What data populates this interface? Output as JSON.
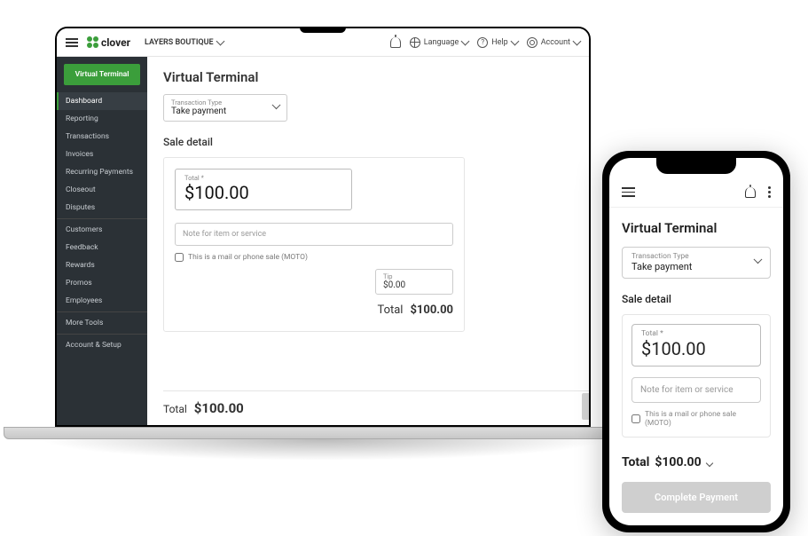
{
  "brand": "clover",
  "merchant": "LAYERS BOUTIQUE",
  "topnav": {
    "language": "Language",
    "help": "Help",
    "account": "Account"
  },
  "sidebar": {
    "vt_button": "Virtual Terminal",
    "items": [
      "Dashboard",
      "Reporting",
      "Transactions",
      "Invoices",
      "Recurring Payments",
      "Closeout",
      "Disputes",
      "Customers",
      "Feedback",
      "Rewards",
      "Promos",
      "Employees",
      "More Tools",
      "Account & Setup"
    ],
    "active_index": 0,
    "dividers_after": [
      6,
      11,
      12
    ]
  },
  "desktop": {
    "title": "Virtual Terminal",
    "txn_type_label": "Transaction Type",
    "txn_type_value": "Take payment",
    "sale_title": "Sale detail",
    "total_label": "Total *",
    "amount": "$100.00",
    "note_placeholder": "Note for item or service",
    "moto_label": "This is a mail or phone sale (MOTO)",
    "tip_label": "Tip",
    "tip_value": "$0.00",
    "inner_total_label": "Total",
    "inner_total_value": "$100.00",
    "footer_total_label": "Total",
    "footer_total_value": "$100.00"
  },
  "mobile": {
    "title": "Virtual Terminal",
    "txn_type_label": "Transaction Type",
    "txn_type_value": "Take payment",
    "sale_title": "Sale detail",
    "total_label": "Total *",
    "amount": "$100.00",
    "note_placeholder": "Note for item or service",
    "moto_label": "This is a mail or phone sale (MOTO)",
    "footer_total_label": "Total",
    "footer_total_value": "$100.00",
    "cta": "Complete Payment"
  }
}
